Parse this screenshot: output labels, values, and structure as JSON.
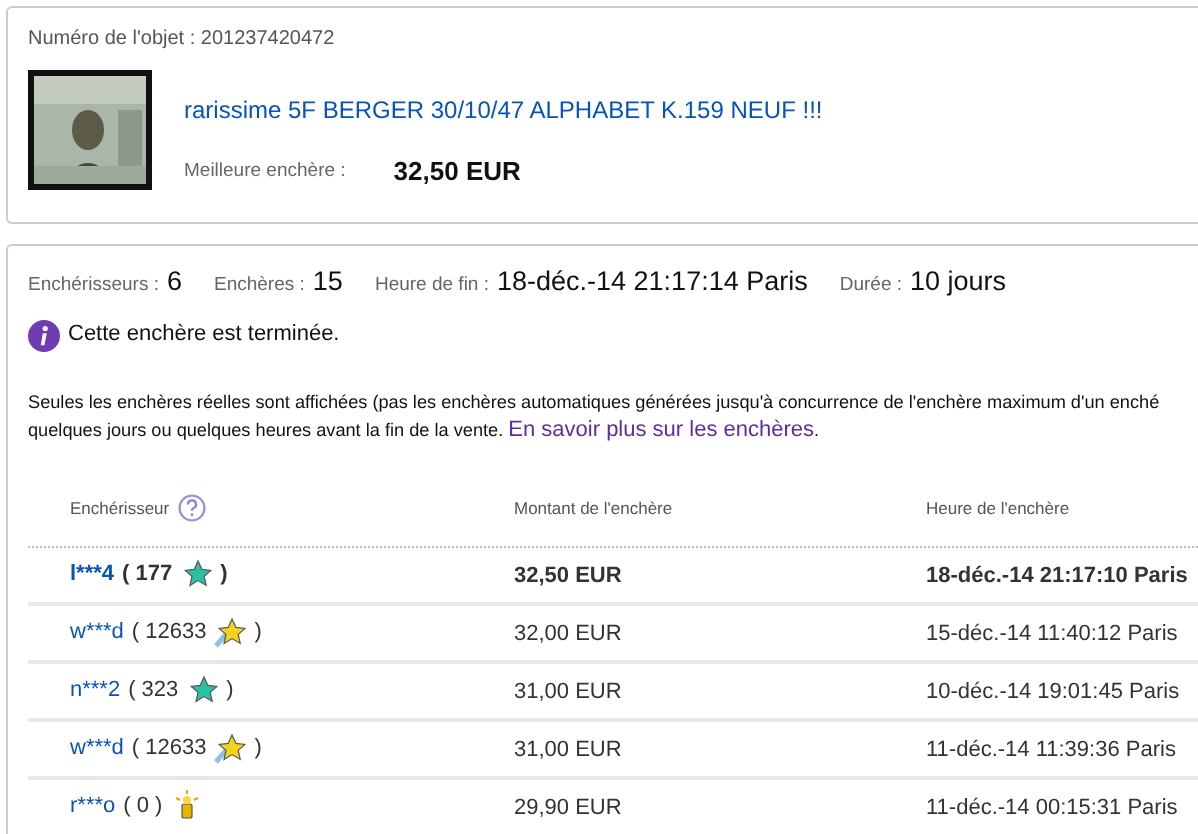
{
  "item": {
    "number_label": "Numéro de l'objet :",
    "number": "201237420472",
    "title": "rarissime 5F BERGER 30/10/47 ALPHABET K.159 NEUF !!!",
    "best_bid_label": "Meilleure enchère :",
    "best_bid": "32,50 EUR"
  },
  "summary": [
    {
      "label": "Enchérisseurs :",
      "value": "6"
    },
    {
      "label": "Enchères :",
      "value": "15"
    },
    {
      "label": "Heure de fin :",
      "value": "18-déc.-14 21:17:14 Paris"
    },
    {
      "label": "Durée :",
      "value": "10 jours"
    }
  ],
  "notice": "Cette enchère est terminée.",
  "disclaimer": {
    "line_1": "Seules les enchères réelles sont affichées (pas les enchères automatiques générées jusqu'à concurrence de l'enchère maximum d'un enché",
    "line_2": "quelques jours ou quelques heures avant la fin de la vente.",
    "link": "En savoir plus sur les enchères",
    "after_link": "."
  },
  "table": {
    "columns": [
      "Enchérisseur",
      "Montant de l'enchère",
      "Heure de l'enchère"
    ],
    "rows": [
      {
        "bidder": "l***4",
        "score": "( 177",
        "kind": "teal-star",
        "close": ")",
        "amount": "32,50 EUR",
        "time": "18-déc.-14 21:17:10 Paris",
        "leading": true
      },
      {
        "bidder": "w***d",
        "score": "( 12633",
        "kind": "shooting-star",
        "close": ")",
        "amount": "32,00 EUR",
        "time": "15-déc.-14 11:40:12 Paris",
        "leading": false
      },
      {
        "bidder": "n***2",
        "score": "( 323",
        "kind": "teal-star",
        "close": ")",
        "amount": "31,00 EUR",
        "time": "10-déc.-14 19:01:45 Paris",
        "leading": false
      },
      {
        "bidder": "w***d",
        "score": "( 12633",
        "kind": "shooting-star",
        "close": ")",
        "amount": "31,00 EUR",
        "time": "11-déc.-14 11:39:36 Paris",
        "leading": false
      },
      {
        "bidder": "r***o",
        "score": "( 0 )",
        "kind": "new-member",
        "amount": "29,90 EUR",
        "time": "11-déc.-14 00:15:31 Paris",
        "leading": false
      }
    ]
  }
}
